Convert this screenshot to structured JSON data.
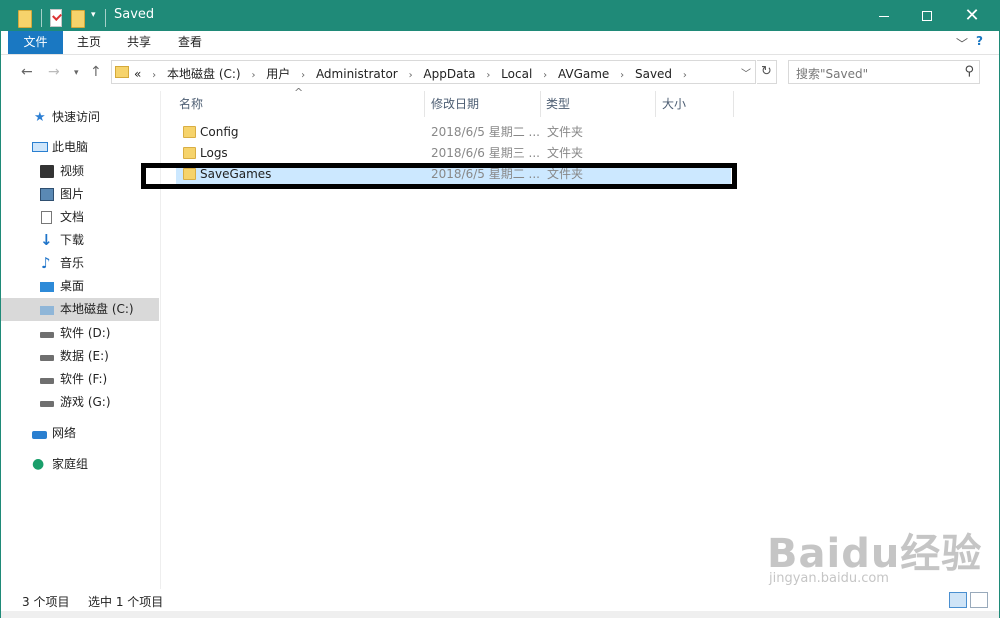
{
  "window": {
    "title": "Saved",
    "accent_color": "#1f8a78",
    "controls": {
      "minimize_icon": "minimize-icon",
      "maximize_icon": "maximize-icon",
      "close_icon": "close-icon"
    }
  },
  "ribbon": {
    "tabs": [
      {
        "label": "文件",
        "active": true
      },
      {
        "label": "主页"
      },
      {
        "label": "共享"
      },
      {
        "label": "查看"
      }
    ],
    "expand_icon": "chevron-down-icon",
    "help_icon": "help-icon"
  },
  "address": {
    "overflow": "«",
    "crumbs": [
      "本地磁盘 (C:)",
      "用户",
      "Administrator",
      "AppData",
      "Local",
      "AVGame",
      "Saved"
    ],
    "search_placeholder": "搜索\"Saved\""
  },
  "sidebar": {
    "quick_access": "快速访问",
    "this_pc": "此电脑",
    "items": [
      "视频",
      "图片",
      "文档",
      "下载",
      "音乐",
      "桌面",
      "本地磁盘 (C:)",
      "软件 (D:)",
      "数据 (E:)",
      "软件 (F:)",
      "游戏 (G:)"
    ],
    "selected": "本地磁盘 (C:)",
    "network": "网络",
    "homegroup": "家庭组"
  },
  "columns": {
    "name": "名称",
    "date": "修改日期",
    "type": "类型",
    "size": "大小"
  },
  "files": [
    {
      "name": "Config",
      "date": "2018/6/5 星期二 ...",
      "type": "文件夹"
    },
    {
      "name": "Logs",
      "date": "2018/6/6 星期三 ...",
      "type": "文件夹"
    },
    {
      "name": "SaveGames",
      "date": "2018/6/5 星期二 ...",
      "type": "文件夹",
      "selected": true
    }
  ],
  "status": {
    "count": "3 个项目",
    "selection": "选中 1 个项目"
  },
  "watermark": {
    "main": "Baidu经验",
    "sub": "jingyan.baidu.com"
  }
}
